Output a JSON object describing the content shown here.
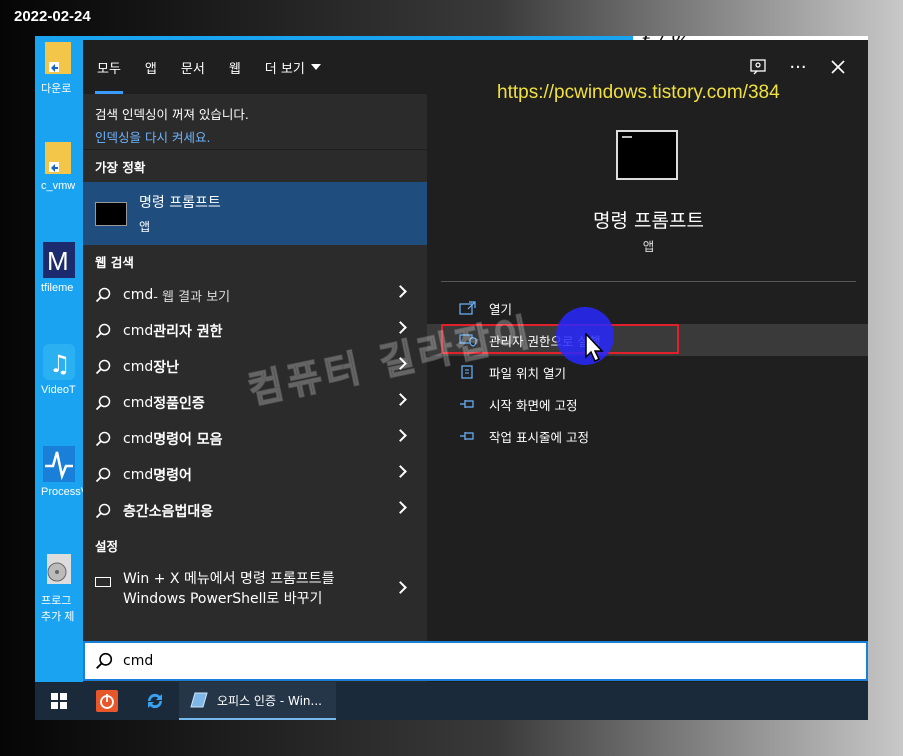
{
  "date_stamp": "2022-02-24",
  "url_overlay": "https://pcwindows.tistory.com/384",
  "watermark": "컴퓨터 길라잡이",
  "desktop_icons": [
    {
      "label": "다운로"
    },
    {
      "label": "c_vmw"
    },
    {
      "label": "tfileme"
    },
    {
      "label": "VideoT"
    },
    {
      "label": "ProcessV"
    },
    {
      "label": "프로그",
      "label2": "추가 제"
    }
  ],
  "tabs": [
    {
      "label": "모두"
    },
    {
      "label": "앱"
    },
    {
      "label": "문서"
    },
    {
      "label": "웹"
    },
    {
      "label": "더 보기"
    }
  ],
  "notice": {
    "line1": "검색 인덱싱이 꺼져 있습니다.",
    "line2": "인덱싱을 다시 켜세요."
  },
  "best_match": {
    "heading": "가장 정확",
    "title": "명령 프롬프트",
    "type": "앱"
  },
  "web_search": {
    "heading": "웹 검색",
    "items": [
      {
        "query": "cmd",
        "suffix": " - 웹 결과 보기"
      },
      {
        "query": "cmd",
        "bold": " 관리자 권한"
      },
      {
        "query": "cmd",
        "bold": " 장난"
      },
      {
        "query": "cmd",
        "bold": " 정품인증"
      },
      {
        "query": "cmd",
        "bold": " 명령어 모음"
      },
      {
        "query": "cmd",
        "bold": " 명령어"
      },
      {
        "query": "",
        "bold": "층간소음법대응"
      }
    ]
  },
  "settings": {
    "heading": "설정",
    "item_line1": "Win + X 메뉴에서 명령 프롬프트를",
    "item_line2": "Windows PowerShell로 바꾸기"
  },
  "preview": {
    "title": "명령 프롬프트",
    "type": "앱"
  },
  "actions": [
    {
      "label": "열기",
      "icon": "open-icon"
    },
    {
      "label": "관리자 권한으로 실행",
      "icon": "shield-icon"
    },
    {
      "label": "파일 위치 열기",
      "icon": "file-location-icon"
    },
    {
      "label": "시작 화면에 고정",
      "icon": "pin-icon"
    },
    {
      "label": "작업 표시줄에 고정",
      "icon": "pin-icon"
    }
  ],
  "search": {
    "value": "cmd"
  },
  "taskbar": {
    "app_label": "오피스 인증 - Win..."
  },
  "colors": {
    "accent": "#3a9bff",
    "selected": "#1e4d7e",
    "highlight_box": "#e0202a",
    "url": "#f0e040"
  }
}
